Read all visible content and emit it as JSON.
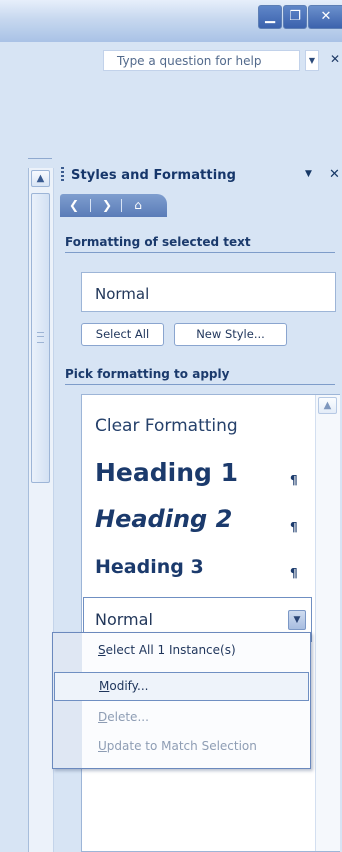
{
  "help": {
    "placeholder": "Type a question for help"
  },
  "taskpane": {
    "title": "Styles and Formatting",
    "section_selected": "Formatting of selected text",
    "selected_style": "Normal",
    "select_all_label": "Select All",
    "new_style_label": "New Style...",
    "section_pick": "Pick formatting to apply",
    "styles": {
      "clear": "Clear Formatting",
      "h1": "Heading 1",
      "h2": "Heading 2",
      "h3": "Heading 3",
      "normal": "Normal"
    },
    "pilcrow": "¶"
  },
  "context_menu": {
    "select_all_instances": {
      "first": "S",
      "rest": "elect All 1 Instance(s)"
    },
    "modify": {
      "first": "M",
      "rest": "odify..."
    },
    "delete": {
      "first": "D",
      "rest": "elete..."
    },
    "update": {
      "first": "U",
      "rest": "pdate to Match Selection"
    }
  },
  "icons": {
    "minimize": "minimize-icon",
    "restore": "restore-icon",
    "close": "close-icon",
    "back": "back-arrow-icon",
    "forward": "forward-arrow-icon",
    "home": "home-icon",
    "dropdown": "chevron-down-icon",
    "scroll_up": "scroll-up-icon"
  },
  "colors": {
    "chrome_blue": "#d7e4f4",
    "heading_text": "#1b3a6c",
    "border": "#9db5d7"
  }
}
